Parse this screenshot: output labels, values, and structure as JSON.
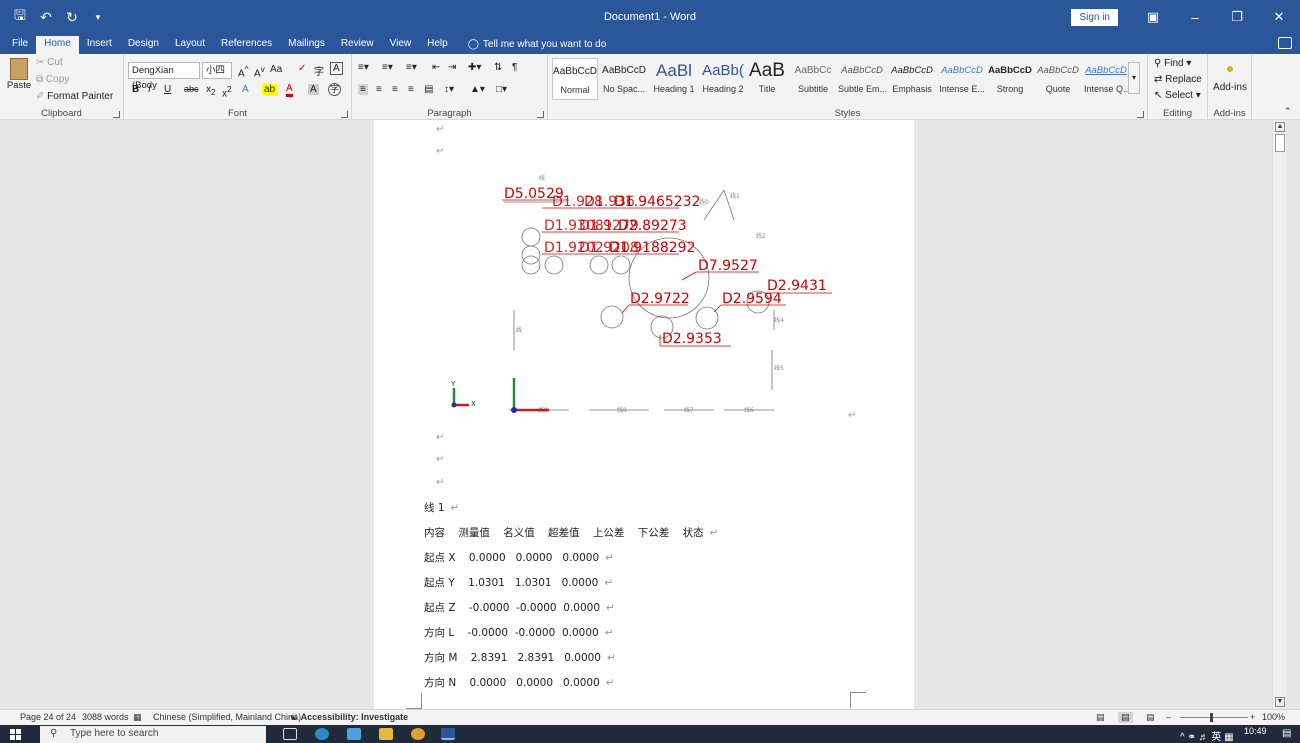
{
  "titlebar": {
    "document_title": "Document1 - Word",
    "sign_in": "Sign in",
    "qat": [
      "save-icon",
      "undo-icon",
      "redo-icon",
      "customize-icon"
    ]
  },
  "tabs": [
    "File",
    "Home",
    "Insert",
    "Design",
    "Layout",
    "References",
    "Mailings",
    "Review",
    "View",
    "Help"
  ],
  "active_tab": "Home",
  "tell_me": "Tell me what you want to do",
  "ribbon": {
    "clipboard": {
      "paste": "Paste",
      "cut": "Cut",
      "copy": "Copy",
      "format_painter": "Format Painter",
      "label": "Clipboard"
    },
    "font": {
      "font_name": "DengXian (Body",
      "font_size": "小四",
      "aa": "Aa",
      "label": "Font"
    },
    "paragraph": {
      "label": "Paragraph"
    },
    "styles": {
      "label": "Styles",
      "items": [
        {
          "sample": "AaBbCcD",
          "name": "Normal"
        },
        {
          "sample": "AaBbCcD",
          "name": "No Spac..."
        },
        {
          "sample": "AaBl",
          "name": "Heading 1"
        },
        {
          "sample": "AaBb(",
          "name": "Heading 2"
        },
        {
          "sample": "AaB",
          "name": "Title"
        },
        {
          "sample": "AaBbCc",
          "name": "Subtitle"
        },
        {
          "sample": "AaBbCcD",
          "name": "Subtle Em..."
        },
        {
          "sample": "AaBbCcD",
          "name": "Emphasis"
        },
        {
          "sample": "AaBbCcD",
          "name": "Intense E..."
        },
        {
          "sample": "AaBbCcD",
          "name": "Strong"
        },
        {
          "sample": "AaBbCcD",
          "name": "Quote"
        },
        {
          "sample": "AaBbCcD",
          "name": "Intense Q..."
        }
      ]
    },
    "editing": {
      "find": "Find",
      "replace": "Replace",
      "select": "Select",
      "label": "Editing"
    },
    "addins": {
      "button": "Add-ins",
      "label": "Add-ins"
    }
  },
  "drawing": {
    "dimensions": [
      "D5.0529",
      "D1.928",
      "D1.936",
      "D1.9465232",
      "D1.93081",
      "D1.9279",
      "D2.89273",
      "D1.9202",
      "D1.9208",
      "D1.9188292",
      "D7.9527",
      "D2.9431",
      "D2.9722",
      "D2.9594",
      "D2.9353"
    ]
  },
  "document": {
    "heading": "线 1",
    "table_header": "内容    测量值    名义值    超差值    上公差    下公差    状态",
    "rows": [
      "起点 X    0.0000   0.0000   0.0000",
      "起点 Y    1.0301   1.0301   0.0000",
      "起点 Z    -0.0000  -0.0000  0.0000",
      "方向 L    -0.0000  -0.0000  0.0000",
      "方向 M    2.8391   2.8391   0.0000",
      "方向 N    0.0000   0.0000   0.0000"
    ]
  },
  "statusbar": {
    "page": "Page 24 of 24",
    "words": "3088 words",
    "language": "Chinese (Simplified, Mainland China)",
    "accessibility": "Accessibility: Investigate",
    "zoom": "100%"
  },
  "taskbar": {
    "search_placeholder": "Type here to search",
    "time": "10:49",
    "ime": "英"
  }
}
